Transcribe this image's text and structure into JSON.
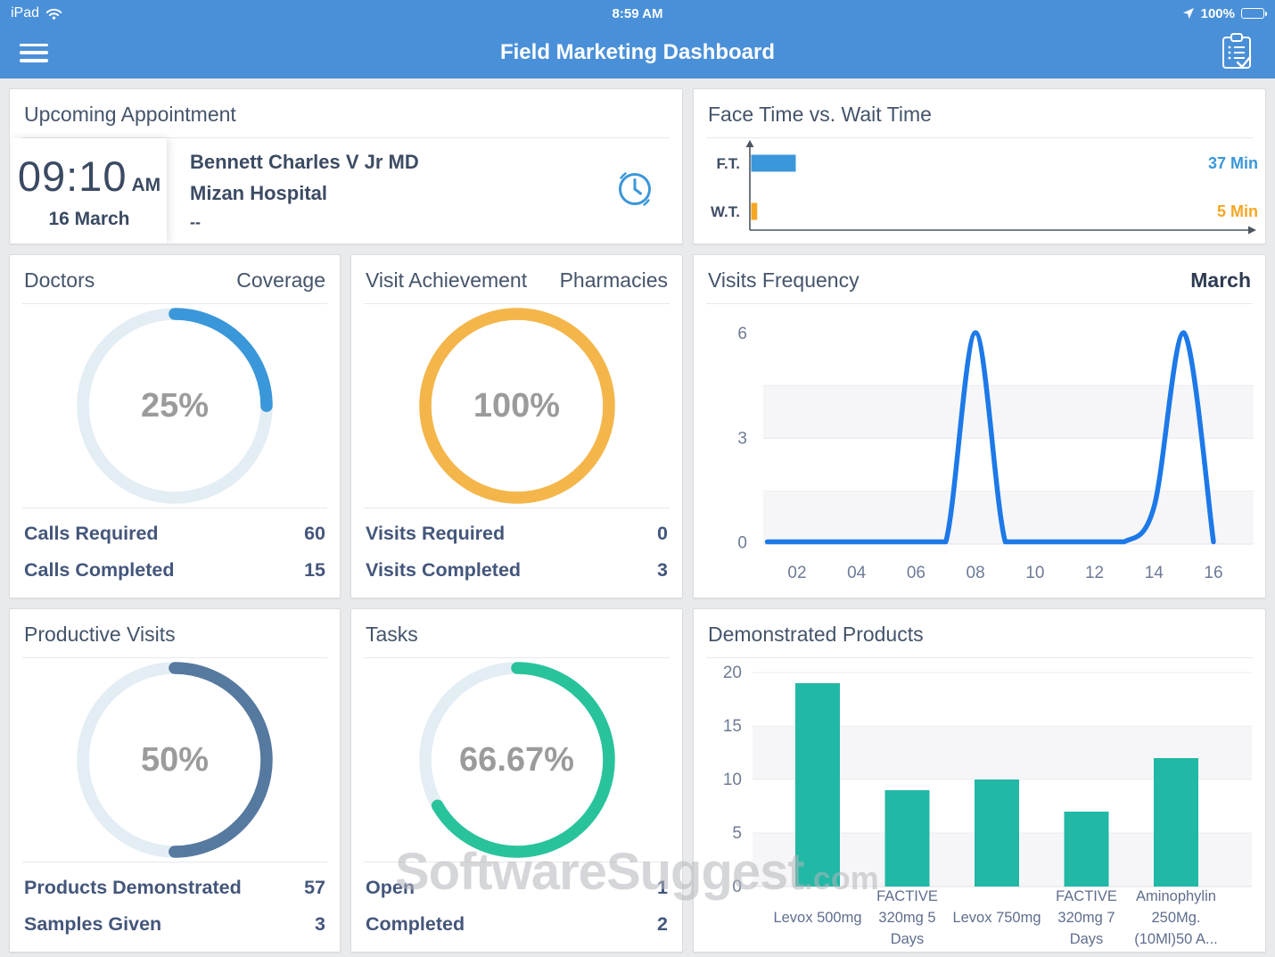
{
  "status_bar": {
    "carrier": "iPad",
    "time": "8:59 AM",
    "battery_percent": "100%"
  },
  "header": {
    "title": "Field Marketing Dashboard"
  },
  "cards": {
    "appointment": {
      "title": "Upcoming Appointment",
      "time": "09:10",
      "meridiem": "AM",
      "date": "16 March",
      "doctor": "Bennett Charles V Jr MD",
      "location": "Mizan Hospital",
      "note": "--"
    },
    "face_time": {
      "title": "Face Time vs. Wait Time"
    },
    "doctors": {
      "title": "Doctors",
      "right_label": "Coverage",
      "stats": [
        {
          "label": "Calls Required",
          "value": "60"
        },
        {
          "label": "Calls Completed",
          "value": "15"
        }
      ]
    },
    "visit_achievement": {
      "title": "Visit Achievement",
      "right_label": "Pharmacies",
      "stats": [
        {
          "label": "Visits Required",
          "value": "0"
        },
        {
          "label": "Visits Completed",
          "value": "3"
        }
      ]
    },
    "visits_frequency": {
      "title": "Visits Frequency",
      "right_label": "March"
    },
    "productive_visits": {
      "title": "Productive Visits",
      "stats": [
        {
          "label": "Products Demonstrated",
          "value": "57"
        },
        {
          "label": "Samples Given",
          "value": "3"
        }
      ]
    },
    "tasks": {
      "title": "Tasks",
      "stats": [
        {
          "label": "Open",
          "value": "1"
        },
        {
          "label": "Completed",
          "value": "2"
        }
      ]
    },
    "demonstrated_products": {
      "title": "Demonstrated Products"
    }
  },
  "watermark": {
    "main": "SoftwareSuggest",
    "suffix": ".com"
  },
  "chart_data": [
    {
      "id": "face_time",
      "render": "bar_h",
      "type": "bar",
      "title": "Face Time vs. Wait Time",
      "categories": [
        "F.T.",
        "W.T."
      ],
      "values": [
        37,
        5
      ],
      "unit": "Min",
      "value_labels": [
        "37 Min",
        "5 Min"
      ],
      "colors": [
        "#3a97d9",
        "#f5a623"
      ],
      "axis_color": "#4d5560",
      "label_color": "#3e4d66"
    },
    {
      "id": "doctors_coverage",
      "render": "donut",
      "type": "pie",
      "title": "Doctors Coverage",
      "value": 25,
      "center_label": "25%",
      "color": "#3a97d9",
      "track_color": "#e3edf4"
    },
    {
      "id": "visit_achievement",
      "render": "donut",
      "type": "pie",
      "title": "Visit Achievement Pharmacies",
      "value": 100,
      "center_label": "100%",
      "color": "#f4b64a",
      "track_color": "#e3edf4"
    },
    {
      "id": "visits_frequency",
      "render": "line",
      "type": "line",
      "title": "Visits Frequency",
      "subtitle": "March",
      "x": [
        1,
        2,
        3,
        4,
        5,
        6,
        7,
        8,
        9,
        10,
        11,
        12,
        13,
        14,
        15,
        16
      ],
      "values": [
        0,
        0,
        0,
        0,
        0,
        0,
        0,
        6,
        0,
        0,
        0,
        0,
        0,
        1,
        6,
        0
      ],
      "x_ticks": [
        "02",
        "04",
        "06",
        "08",
        "10",
        "12",
        "14",
        "16"
      ],
      "y_ticks": [
        0,
        3,
        6
      ],
      "ylim": [
        0,
        6
      ],
      "line_color": "#1d79e8",
      "band_color": "#f6f6f8",
      "tick_color": "#6e7b95",
      "grid": "striped",
      "legend": "none"
    },
    {
      "id": "productive_visits",
      "render": "donut",
      "type": "pie",
      "title": "Productive Visits",
      "value": 50,
      "center_label": "50%",
      "color": "#56799f",
      "track_color": "#e3edf4"
    },
    {
      "id": "tasks",
      "render": "donut",
      "type": "pie",
      "title": "Tasks",
      "value": 66.67,
      "center_label": "66.67%",
      "color": "#29c39b",
      "track_color": "#e3edf4"
    },
    {
      "id": "demonstrated_products",
      "render": "bar",
      "type": "bar",
      "title": "Demonstrated Products",
      "categories": [
        "Levox 500mg",
        "FACTIVE 320mg 5 Days",
        "Levox 750mg",
        "FACTIVE 320mg 7 Days",
        "Aminophylin 250Mg. (10Ml)50 A..."
      ],
      "category_lines": [
        [
          "Levox 500mg"
        ],
        [
          "FACTIVE",
          "320mg 5",
          "Days"
        ],
        [
          "Levox 750mg"
        ],
        [
          "FACTIVE",
          "320mg 7",
          "Days"
        ],
        [
          "Aminophylin",
          "250Mg.",
          "(10Ml)50 A..."
        ]
      ],
      "values": [
        19,
        9,
        10,
        7,
        12
      ],
      "y_ticks": [
        0,
        5,
        10,
        15,
        20
      ],
      "ylim": [
        0,
        20
      ],
      "bar_color": "#21b8a5",
      "band_color": "#f6f6f8",
      "tick_color": "#6e7b95",
      "grid": "striped",
      "legend": "none"
    }
  ]
}
